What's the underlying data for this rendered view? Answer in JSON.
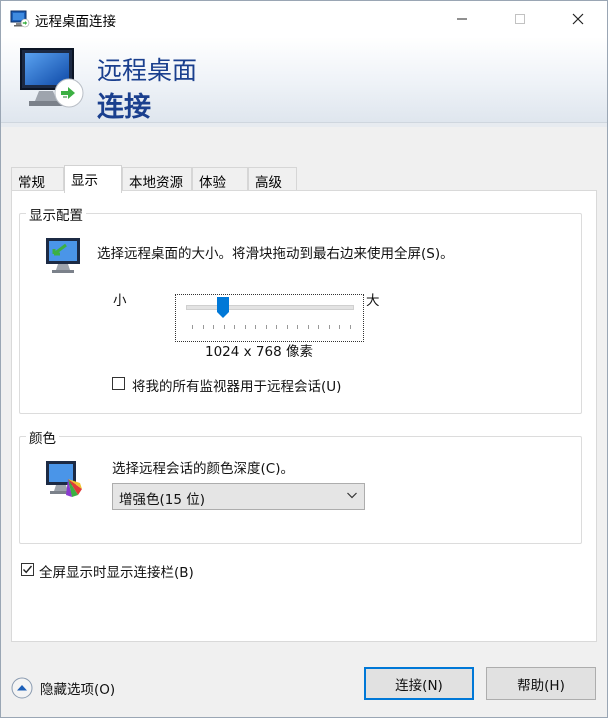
{
  "window": {
    "title": "远程桌面连接"
  },
  "banner": {
    "line1": "远程桌面",
    "line2": "连接"
  },
  "tabs": [
    {
      "label": "常规"
    },
    {
      "label": "显示"
    },
    {
      "label": "本地资源"
    },
    {
      "label": "体验"
    },
    {
      "label": "高级"
    }
  ],
  "active_tab": "显示",
  "display_config": {
    "group_label": "显示配置",
    "instruction": "选择远程桌面的大小。将滑块拖动到最右边来使用全屏(S)。",
    "slider_min_label": "小",
    "slider_max_label": "大",
    "slider_position": 0.2,
    "resolution": "1024 x 768 像素",
    "use_all_monitors_label": "将我的所有监视器用于远程会话(U)",
    "use_all_monitors_checked": false
  },
  "colors": {
    "group_label": "颜色",
    "instruction": "选择远程会话的颜色深度(C)。",
    "selected_depth": "增强色(15 位)"
  },
  "fullscreen_bar": {
    "label": "全屏显示时显示连接栏(B)",
    "checked": true
  },
  "footer": {
    "hide_options_label": "隐藏选项(O)",
    "connect_label": "连接(N)",
    "help_label": "帮助(H)"
  },
  "theme": {
    "accent": "#0078d7",
    "banner_text": "#1a3f8e"
  }
}
